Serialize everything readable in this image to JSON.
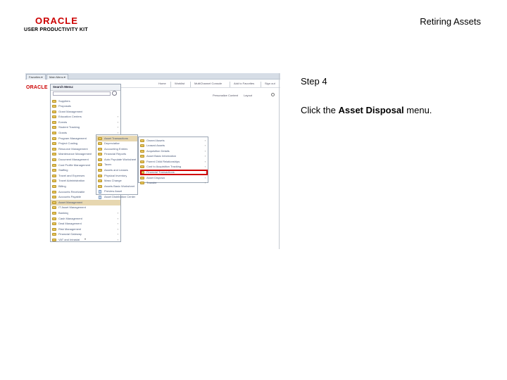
{
  "header": {
    "logo_oracle": "ORACLE",
    "logo_sub": "USER PRODUCTIVITY KIT",
    "doc_title": "Retiring Assets"
  },
  "step": {
    "label": "Step 4",
    "instruction_pre": "Click the ",
    "instruction_bold": "Asset Disposal",
    "instruction_post": " menu."
  },
  "screenshot": {
    "tabs": [
      "Favorites ▾",
      "Main Menu ▾"
    ],
    "brand": "ORACLE",
    "topnav": [
      "Home",
      "Worklist",
      "MultiChannel Console",
      "Add to Favorites",
      "Sign out"
    ],
    "subnav": [
      "Personalize Content",
      "Layout"
    ],
    "menu1": {
      "title": "Search Menu:",
      "items": [
        {
          "label": "Suppliers",
          "icon": "folder",
          "arrow": ""
        },
        {
          "label": "Proposals",
          "icon": "folder",
          "arrow": ""
        },
        {
          "label": "Grant Management",
          "icon": "folder",
          "arrow": ""
        },
        {
          "label": "Education Centers",
          "icon": "folder",
          "arrow": "›"
        },
        {
          "label": "Events",
          "icon": "folder",
          "arrow": "›"
        },
        {
          "label": "Student Tracking",
          "icon": "folder",
          "arrow": "›"
        },
        {
          "label": "Grants",
          "icon": "folder",
          "arrow": "›"
        },
        {
          "label": "Program Management",
          "icon": "folder",
          "arrow": ""
        },
        {
          "label": "Project Costing",
          "icon": "folder",
          "arrow": ""
        },
        {
          "label": "Resource Management",
          "icon": "folder",
          "arrow": ""
        },
        {
          "label": "Maintenance Management",
          "icon": "folder",
          "arrow": ""
        },
        {
          "label": "Document Management",
          "icon": "folder",
          "arrow": ""
        },
        {
          "label": "Cost Profile Management",
          "icon": "folder",
          "arrow": ""
        },
        {
          "label": "Staffing",
          "icon": "folder",
          "arrow": ""
        },
        {
          "label": "Travel and Expenses",
          "icon": "folder",
          "arrow": ""
        },
        {
          "label": "Travel Administration",
          "icon": "folder",
          "arrow": ""
        },
        {
          "label": "Billing",
          "icon": "folder",
          "arrow": ""
        },
        {
          "label": "Accounts Receivable",
          "icon": "folder",
          "arrow": ""
        },
        {
          "label": "Accounts Payable",
          "icon": "folder",
          "arrow": ""
        },
        {
          "label": "Asset Management",
          "icon": "folder",
          "arrow": "",
          "highlight": true
        },
        {
          "label": "IT Asset Management",
          "icon": "folder",
          "arrow": ""
        },
        {
          "label": "Banking",
          "icon": "folder",
          "arrow": "›"
        },
        {
          "label": "Cash Management",
          "icon": "folder",
          "arrow": "›"
        },
        {
          "label": "Deal Management",
          "icon": "folder",
          "arrow": "›"
        },
        {
          "label": "Risk Management",
          "icon": "folder",
          "arrow": "›"
        },
        {
          "label": "Financial Gateway",
          "icon": "folder",
          "arrow": "›"
        },
        {
          "label": "VAT and Intrastat",
          "icon": "folder",
          "arrow": "›"
        }
      ],
      "scroll_marker": "▾"
    },
    "menu2": {
      "items": [
        {
          "label": "Asset Transactions",
          "icon": "folder",
          "arrow": "",
          "highlight": true
        },
        {
          "label": "Depreciation",
          "icon": "folder",
          "arrow": ""
        },
        {
          "label": "Accounting Entries",
          "icon": "folder",
          "arrow": ""
        },
        {
          "label": "Financial Reports",
          "icon": "folder",
          "arrow": ""
        },
        {
          "label": "Auto Populate Worksheet",
          "icon": "folder",
          "arrow": ""
        },
        {
          "label": "Taxes",
          "icon": "folder",
          "arrow": ""
        },
        {
          "label": "Assets and Leases",
          "icon": "folder",
          "arrow": ""
        },
        {
          "label": "Physical Inventory",
          "icon": "folder",
          "arrow": ""
        },
        {
          "label": "Mass Change",
          "icon": "folder",
          "arrow": ""
        },
        {
          "label": "Assets Basic Worksheet",
          "icon": "folder",
          "arrow": ""
        },
        {
          "label": "Preview Asset",
          "icon": "doc",
          "arrow": ""
        },
        {
          "label": "Asset Distribution Center",
          "icon": "doc",
          "arrow": ""
        }
      ]
    },
    "menu3": {
      "items": [
        {
          "label": "Owned Assets",
          "icon": "folder",
          "arrow": "›"
        },
        {
          "label": "Leased Assets",
          "icon": "folder",
          "arrow": "›"
        },
        {
          "label": "Acquisition Details",
          "icon": "folder",
          "arrow": "›"
        },
        {
          "label": "Asset Basic Information",
          "icon": "folder",
          "arrow": "›"
        },
        {
          "label": "Parent Child Relationships",
          "icon": "folder",
          "arrow": "›"
        },
        {
          "label": "Cost to Acquisition Tracking",
          "icon": "folder",
          "arrow": "›"
        },
        {
          "label": "Financial Transactions",
          "icon": "folder",
          "arrow": "›"
        },
        {
          "label": "Asset Disposal",
          "icon": "folder",
          "arrow": "›",
          "target": true
        },
        {
          "label": "Transfer",
          "icon": "folder",
          "arrow": "›"
        }
      ]
    }
  },
  "colors": {
    "brand_red": "#cc0000",
    "target_box": "#d00000",
    "menu_text": "#4a5a7a"
  }
}
